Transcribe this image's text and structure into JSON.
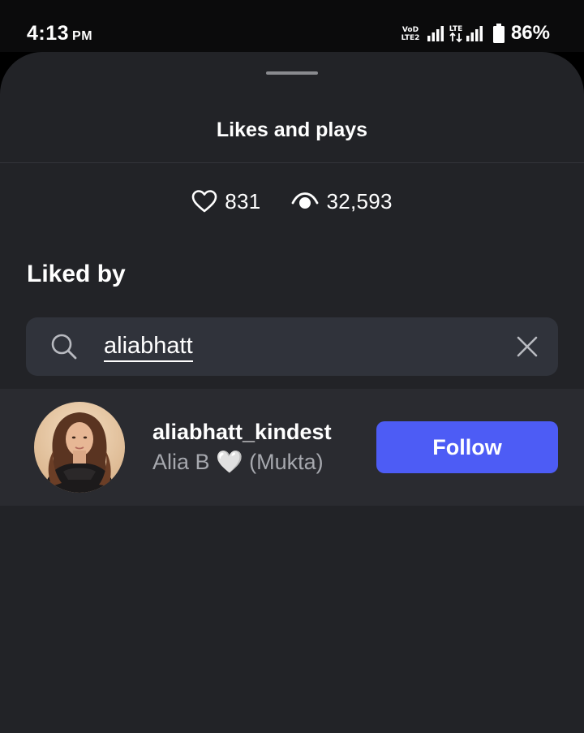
{
  "status_bar": {
    "time": "4:13",
    "ampm": "PM",
    "battery_percent": "86%",
    "icons": [
      "vod-lte-icon",
      "signal-icon",
      "lte-icon",
      "signal-icon",
      "battery-icon"
    ]
  },
  "sheet": {
    "title": "Likes and plays",
    "likes": {
      "icon": "heart-icon",
      "value": "831"
    },
    "plays": {
      "icon": "eye-icon",
      "value": "32,593"
    },
    "section_heading": "Liked by"
  },
  "search": {
    "icon": "search-icon",
    "value": "aliabhatt",
    "clear_icon": "close-icon"
  },
  "results": [
    {
      "username": "aliabhatt_kindest",
      "display_name": "Alia B 🤍 (Mukta)",
      "follow_label": "Follow"
    }
  ],
  "colors": {
    "sheet_background": "#222327",
    "search_background": "#30333b",
    "row_background": "#2a2b30",
    "follow_button": "#4d5cf5",
    "secondary_text": "#a6a8ae"
  }
}
